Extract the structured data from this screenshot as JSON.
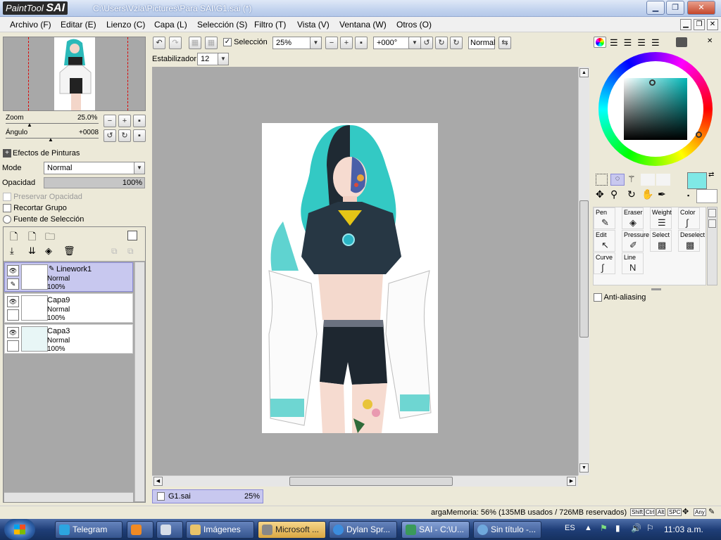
{
  "window": {
    "app_logo_text": "PaintTool",
    "app_logo_bold": "SAI",
    "title": "C:\\Users\\Vzla\\Pictures\\Para SAI\\G1.sai (*)"
  },
  "menu": [
    "Archivo (F)",
    "Editar (E)",
    "Lienzo (C)",
    "Capa (L)",
    "Selección (S)",
    "Filtro (T)",
    "Vista (V)",
    "Ventana (W)",
    "Otros (O)"
  ],
  "toolbar": {
    "selection_label": "Selección",
    "zoom_value": "25%",
    "rotation_value": "+000°",
    "blend_mode": "Normal",
    "stabilizer_label": "Estabilizador",
    "stabilizer_value": "12"
  },
  "navigator": {
    "zoom_label": "Zoom",
    "zoom_value": "25.0%",
    "angle_label": "Ángulo",
    "angle_value": "+0008"
  },
  "layer_panel": {
    "effects_label": "Efectos de Pinturas",
    "mode_label": "Mode",
    "mode_value": "Normal",
    "opacity_label": "Opacidad",
    "opacity_value": "100%",
    "preserve_opacity": "Preservar Opacidad",
    "clip_group": "Recortar Grupo",
    "selection_source": "Fuente de Selección",
    "layers": [
      {
        "name": "Linework1",
        "mode": "Normal",
        "opacity": "100%"
      },
      {
        "name": "Capa9",
        "mode": "Normal",
        "opacity": "100%"
      },
      {
        "name": "Capa3",
        "mode": "Normal",
        "opacity": "100%"
      }
    ]
  },
  "tools": {
    "row1": [
      "Pen",
      "Eraser",
      "Weight",
      "Color"
    ],
    "row2": [
      "Edit",
      "Pressure",
      "Select",
      "Deselect"
    ],
    "row3": [
      "Curve",
      "Line"
    ],
    "anti_aliasing": "Anti-aliasing"
  },
  "doc_tab": {
    "name": "G1.sai",
    "zoom": "25%"
  },
  "status": {
    "memory": "argaMemoria: 56% (135MB usados / 726MB reservados)",
    "keys": [
      "Shift",
      "Ctrl",
      "Alt",
      "SPC",
      "Any"
    ]
  },
  "taskbar": {
    "items": [
      "Telegram",
      "",
      "",
      "Imágenes",
      "Microsoft ...",
      "Dylan Spr...",
      "SAI - C:\\U...",
      "Sin título -..."
    ],
    "lang": "ES",
    "clock": "11:03 a.m."
  },
  "colors": {
    "selected_layer": "#c8c8ef",
    "current_color": "#7fe8e6",
    "canvas_bg": "#a9a9a9"
  }
}
